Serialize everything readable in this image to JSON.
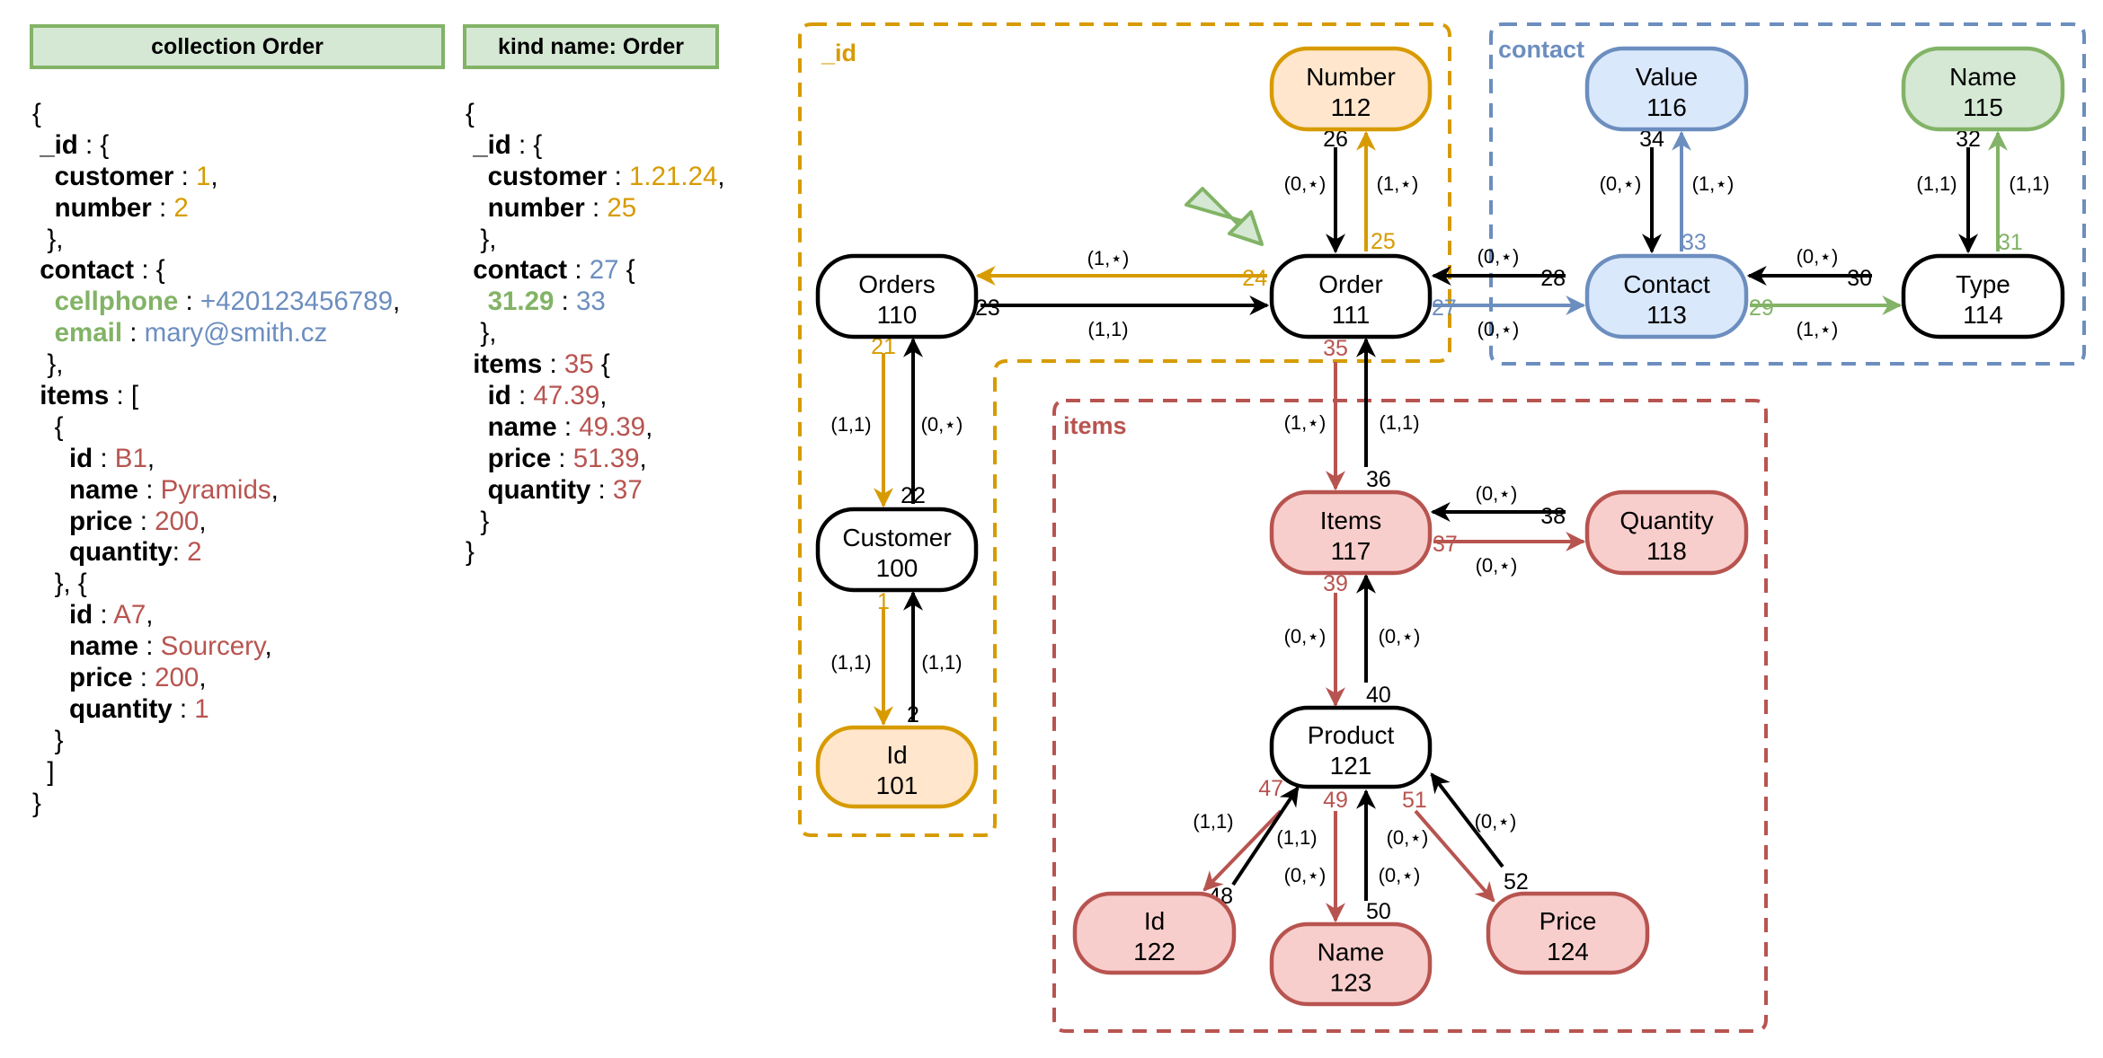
{
  "colors": {
    "orange": "#d79b00",
    "orange_fill": "#ffe6cc",
    "blue": "#6c8ebf",
    "blue_fill": "#dae8fc",
    "green": "#82b366",
    "green_fill": "#d5e8d4",
    "red": "#b85450",
    "red_fill": "#f8cecc",
    "black": "#000000"
  },
  "headers": {
    "collection": "collection Order",
    "kind": "kind name: Order"
  },
  "code_left": [
    [
      {
        "t": "{"
      }
    ],
    [
      {
        "t": " "
      },
      {
        "t": "_id",
        "k": 1
      },
      {
        "t": " : {"
      }
    ],
    [
      {
        "t": "   "
      },
      {
        "t": "customer",
        "k": 1
      },
      {
        "t": " : "
      },
      {
        "t": "1",
        "c": "orange"
      },
      {
        "t": ","
      }
    ],
    [
      {
        "t": "   "
      },
      {
        "t": "number",
        "k": 1
      },
      {
        "t": " : "
      },
      {
        "t": "2",
        "c": "orange"
      }
    ],
    [
      {
        "t": "  },"
      }
    ],
    [
      {
        "t": " "
      },
      {
        "t": "contact",
        "k": 1
      },
      {
        "t": " : {"
      }
    ],
    [
      {
        "t": "   "
      },
      {
        "t": "cellphone",
        "k": 1,
        "c": "green"
      },
      {
        "t": " : "
      },
      {
        "t": "+420123456789",
        "c": "blue"
      },
      {
        "t": ","
      }
    ],
    [
      {
        "t": "   "
      },
      {
        "t": "email",
        "k": 1,
        "c": "green"
      },
      {
        "t": " : "
      },
      {
        "t": "mary@smith.cz",
        "c": "blue"
      }
    ],
    [
      {
        "t": "  },"
      }
    ],
    [
      {
        "t": " "
      },
      {
        "t": "items",
        "k": 1
      },
      {
        "t": " : ["
      }
    ],
    [
      {
        "t": "   {"
      }
    ],
    [
      {
        "t": "     "
      },
      {
        "t": "id",
        "k": 1
      },
      {
        "t": " : "
      },
      {
        "t": "B1",
        "c": "red"
      },
      {
        "t": ","
      }
    ],
    [
      {
        "t": "     "
      },
      {
        "t": "name",
        "k": 1
      },
      {
        "t": " : "
      },
      {
        "t": "Pyramids",
        "c": "red"
      },
      {
        "t": ","
      }
    ],
    [
      {
        "t": "     "
      },
      {
        "t": "price",
        "k": 1
      },
      {
        "t": " : "
      },
      {
        "t": "200",
        "c": "red"
      },
      {
        "t": ","
      }
    ],
    [
      {
        "t": "     "
      },
      {
        "t": "quantity",
        "k": 1
      },
      {
        "t": ": "
      },
      {
        "t": "2",
        "c": "red"
      }
    ],
    [
      {
        "t": "   }, {"
      }
    ],
    [
      {
        "t": "     "
      },
      {
        "t": "id",
        "k": 1
      },
      {
        "t": " : "
      },
      {
        "t": "A7",
        "c": "red"
      },
      {
        "t": ","
      }
    ],
    [
      {
        "t": "     "
      },
      {
        "t": "name",
        "k": 1
      },
      {
        "t": " : "
      },
      {
        "t": "Sourcery",
        "c": "red"
      },
      {
        "t": ","
      }
    ],
    [
      {
        "t": "     "
      },
      {
        "t": "price",
        "k": 1
      },
      {
        "t": " : "
      },
      {
        "t": "200",
        "c": "red"
      },
      {
        "t": ","
      }
    ],
    [
      {
        "t": "     "
      },
      {
        "t": "quantity",
        "k": 1
      },
      {
        "t": " : "
      },
      {
        "t": "1",
        "c": "red"
      }
    ],
    [
      {
        "t": "   }"
      }
    ],
    [
      {
        "t": "  ]"
      }
    ],
    [
      {
        "t": "}"
      }
    ]
  ],
  "code_right": [
    [
      {
        "t": "{"
      }
    ],
    [
      {
        "t": " "
      },
      {
        "t": "_id",
        "k": 1
      },
      {
        "t": " : {"
      }
    ],
    [
      {
        "t": "   "
      },
      {
        "t": "customer",
        "k": 1
      },
      {
        "t": " : "
      },
      {
        "t": "1.21.24",
        "c": "orange"
      },
      {
        "t": ","
      }
    ],
    [
      {
        "t": "   "
      },
      {
        "t": "number",
        "k": 1
      },
      {
        "t": " : "
      },
      {
        "t": "25",
        "c": "orange"
      }
    ],
    [
      {
        "t": "  },"
      }
    ],
    [
      {
        "t": " "
      },
      {
        "t": "contact",
        "k": 1
      },
      {
        "t": " : "
      },
      {
        "t": "27",
        "c": "blue"
      },
      {
        "t": " {"
      }
    ],
    [
      {
        "t": "   "
      },
      {
        "t": "31.29",
        "k": 1,
        "c": "green"
      },
      {
        "t": " : "
      },
      {
        "t": "33",
        "c": "blue"
      }
    ],
    [
      {
        "t": "  },"
      }
    ],
    [
      {
        "t": " "
      },
      {
        "t": "items",
        "k": 1
      },
      {
        "t": " : "
      },
      {
        "t": "35",
        "c": "red"
      },
      {
        "t": " {"
      }
    ],
    [
      {
        "t": "   "
      },
      {
        "t": "id",
        "k": 1
      },
      {
        "t": " : "
      },
      {
        "t": "47.39",
        "c": "red"
      },
      {
        "t": ","
      }
    ],
    [
      {
        "t": "   "
      },
      {
        "t": "name",
        "k": 1
      },
      {
        "t": " : "
      },
      {
        "t": "49.39",
        "c": "red"
      },
      {
        "t": ","
      }
    ],
    [
      {
        "t": "   "
      },
      {
        "t": "price",
        "k": 1
      },
      {
        "t": " : "
      },
      {
        "t": "51.39",
        "c": "red"
      },
      {
        "t": ","
      }
    ],
    [
      {
        "t": "   "
      },
      {
        "t": "quantity",
        "k": 1
      },
      {
        "t": " : "
      },
      {
        "t": "37",
        "c": "red"
      }
    ],
    [
      {
        "t": "  }"
      }
    ],
    [
      {
        "t": "}"
      }
    ]
  ],
  "frames": [
    {
      "id": "id-frame",
      "label": "_id",
      "color": "orange"
    },
    {
      "id": "contact-frame",
      "label": "contact",
      "color": "blue"
    },
    {
      "id": "items-frame",
      "label": "items",
      "color": "red"
    }
  ],
  "nodes": [
    {
      "id": "orders",
      "name": "Orders",
      "num": "110",
      "style": "plain"
    },
    {
      "id": "order",
      "name": "Order",
      "num": "111",
      "style": "plain"
    },
    {
      "id": "number",
      "name": "Number",
      "num": "112",
      "style": "orange"
    },
    {
      "id": "customer",
      "name": "Customer",
      "num": "100",
      "style": "plain"
    },
    {
      "id": "id101",
      "name": "Id",
      "num": "101",
      "style": "orange"
    },
    {
      "id": "value",
      "name": "Value",
      "num": "116",
      "style": "blue"
    },
    {
      "id": "name115",
      "name": "Name",
      "num": "115",
      "style": "green"
    },
    {
      "id": "contact",
      "name": "Contact",
      "num": "113",
      "style": "blue"
    },
    {
      "id": "type",
      "name": "Type",
      "num": "114",
      "style": "plain"
    },
    {
      "id": "items",
      "name": "Items",
      "num": "117",
      "style": "red"
    },
    {
      "id": "quantity",
      "name": "Quantity",
      "num": "118",
      "style": "red"
    },
    {
      "id": "product",
      "name": "Product",
      "num": "121",
      "style": "plain"
    },
    {
      "id": "id122",
      "name": "Id",
      "num": "122",
      "style": "red"
    },
    {
      "id": "name123",
      "name": "Name",
      "num": "123",
      "style": "red"
    },
    {
      "id": "price124",
      "name": "Price",
      "num": "124",
      "style": "red"
    }
  ],
  "edges": [
    {
      "from": "order",
      "to": "orders",
      "label": "24",
      "card": "(1,*)",
      "color": "orange"
    },
    {
      "from": "orders",
      "to": "order",
      "label": "23",
      "card": "(1,1)",
      "color": "black"
    },
    {
      "from": "number",
      "to": "order",
      "label": "26",
      "card": "(0,*)",
      "color": "black"
    },
    {
      "from": "order",
      "to": "number",
      "label": "25",
      "card": "(1,*)",
      "color": "orange"
    },
    {
      "from": "orders",
      "to": "customer",
      "label": "21",
      "card": "(1,1)",
      "color": "orange"
    },
    {
      "from": "customer",
      "to": "orders",
      "label": "22",
      "card": "(0,*)",
      "color": "black"
    },
    {
      "from": "customer",
      "to": "id101",
      "label": "1",
      "card": "(1,1)",
      "color": "orange"
    },
    {
      "from": "id101",
      "to": "customer",
      "label": "2",
      "card": "(1,1)",
      "color": "black"
    },
    {
      "from": "contact",
      "to": "order",
      "label": "28",
      "card": "(0,*)",
      "color": "black"
    },
    {
      "from": "order",
      "to": "contact",
      "label": "27",
      "card": "(0,*)",
      "color": "blue"
    },
    {
      "from": "value",
      "to": "contact",
      "label": "34",
      "card": "(0,*)",
      "color": "black"
    },
    {
      "from": "contact",
      "to": "value",
      "label": "33",
      "card": "(1,*)",
      "color": "blue"
    },
    {
      "from": "type",
      "to": "contact",
      "label": "30",
      "card": "(0,*)",
      "color": "black"
    },
    {
      "from": "contact",
      "to": "type",
      "label": "29",
      "card": "(1,*)",
      "color": "green"
    },
    {
      "from": "name115",
      "to": "type",
      "label": "32",
      "card": "(1,1)",
      "color": "black"
    },
    {
      "from": "type",
      "to": "name115",
      "label": "31",
      "card": "(1,1)",
      "color": "green"
    },
    {
      "from": "order",
      "to": "items",
      "label": "35",
      "card": "(1,*)",
      "color": "red"
    },
    {
      "from": "items",
      "to": "order",
      "label": "36",
      "card": "(1,1)",
      "color": "black"
    },
    {
      "from": "quantity",
      "to": "items",
      "label": "38",
      "card": "(0,*)",
      "color": "black"
    },
    {
      "from": "items",
      "to": "quantity",
      "label": "37",
      "card": "(0,*)",
      "color": "red"
    },
    {
      "from": "items",
      "to": "product",
      "label": "39",
      "card": "(0,*)",
      "color": "red"
    },
    {
      "from": "product",
      "to": "items",
      "label": "40",
      "card": "(0,*)",
      "color": "black"
    },
    {
      "from": "product",
      "to": "id122",
      "label": "47",
      "card": "(1,1)",
      "color": "red"
    },
    {
      "from": "id122",
      "to": "product",
      "label": "48",
      "card": "(1,1)",
      "color": "black"
    },
    {
      "from": "product",
      "to": "name123",
      "label": "49",
      "card": "(0,*)",
      "color": "red"
    },
    {
      "from": "name123",
      "to": "product",
      "label": "50",
      "card": "(0,*)",
      "color": "black"
    },
    {
      "from": "product",
      "to": "price124",
      "label": "51",
      "card": "(0,*)",
      "color": "red"
    },
    {
      "from": "price124",
      "to": "product",
      "label": "52",
      "card": "(0,*)",
      "color": "black"
    }
  ],
  "pointer": {
    "icon": "green-arrow-icon"
  }
}
